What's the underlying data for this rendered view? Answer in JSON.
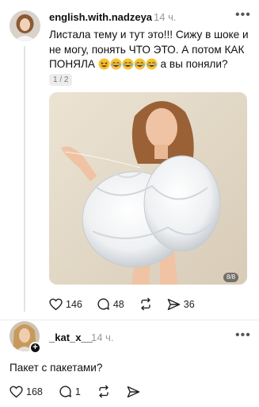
{
  "post": {
    "username": "english.with.nadzeya",
    "time": "14 ч.",
    "more_icon": "more-horizontal-icon",
    "text_main": "Листала тему и тут это!!! Сижу в шоке и не могу, понять ЧТО ЭТО. А потом КАК ПОНЯЛА",
    "text_tail": "а вы поняли?",
    "emojis": [
      "grin-squint-emoji",
      "joy-emoji",
      "joy-emoji",
      "joy-emoji",
      "joy-emoji"
    ],
    "text_pager": "1 / 2",
    "image_counter": "8/8",
    "actions": {
      "likes": "146",
      "comments": "48",
      "shares": "36"
    }
  },
  "reply": {
    "username": "_kat_x__",
    "time": "14 ч.",
    "text": "Пакет с пакетами?",
    "actions": {
      "likes": "168",
      "comments": "1"
    }
  },
  "colors": {
    "text": "#101010",
    "muted": "#999999",
    "divider": "#ececec"
  }
}
